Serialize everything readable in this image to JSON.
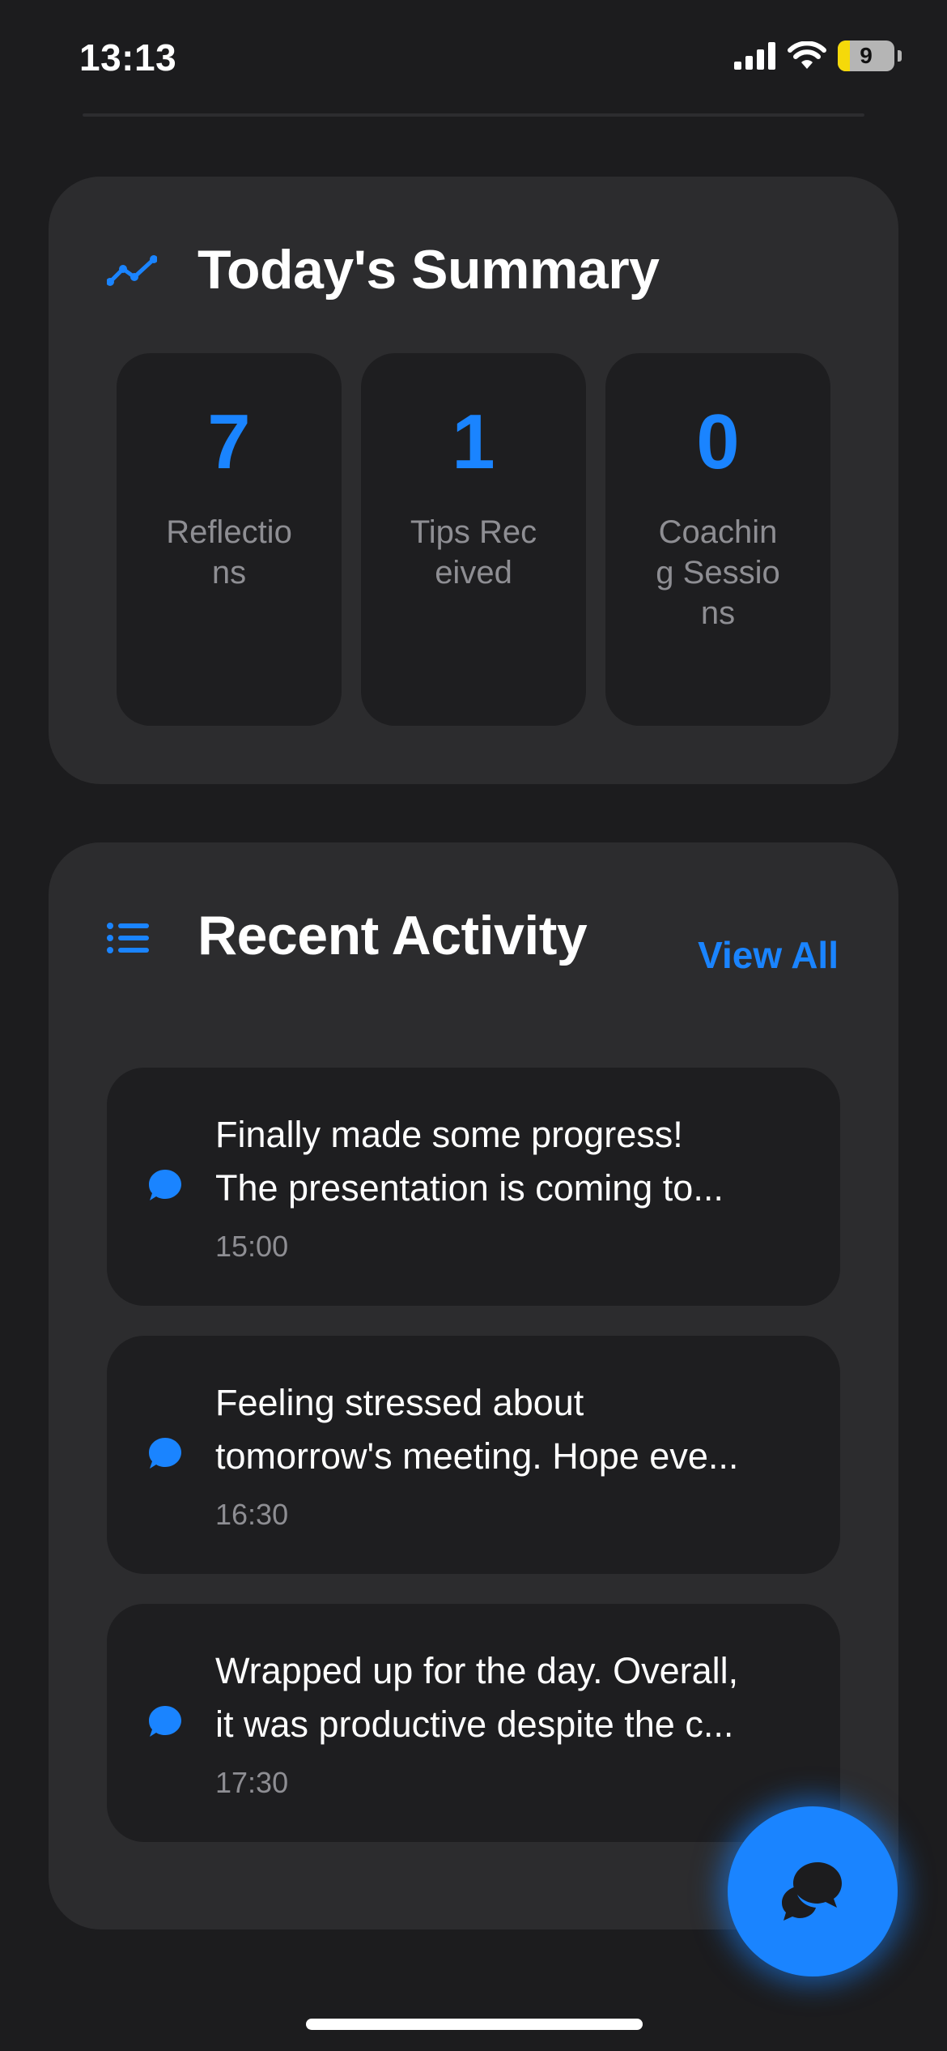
{
  "status_bar": {
    "time": "13:13",
    "battery_level": "9",
    "icons": [
      "cellular-signal-icon",
      "wifi-icon",
      "battery-icon"
    ]
  },
  "summary": {
    "title": "Today's Summary",
    "icon": "trend-line-icon",
    "stats": [
      {
        "value": "7",
        "label": "Reflections"
      },
      {
        "value": "1",
        "label": "Tips Received"
      },
      {
        "value": "0",
        "label": "Coaching Sessions"
      }
    ]
  },
  "activity": {
    "title": "Recent Activity",
    "icon": "list-icon",
    "view_all_label": "View All",
    "items": [
      {
        "line1": "Finally made some progress!",
        "line2": "The presentation is coming to...",
        "time": "15:00",
        "icon": "chat-bubble-icon"
      },
      {
        "line1": "Feeling stressed about",
        "line2": "tomorrow's meeting. Hope eve...",
        "time": "16:30",
        "icon": "chat-bubble-icon"
      },
      {
        "line1": "Wrapped up for the day. Overall,",
        "line2": "it was productive despite the c...",
        "time": "17:30",
        "icon": "chat-bubble-icon"
      }
    ]
  },
  "fab": {
    "icon": "chat-bubbles-icon"
  },
  "colors": {
    "background": "#1c1c1e",
    "card": "#2c2c2e",
    "tile": "#1e1e20",
    "accent": "#1a84ff",
    "secondary_text": "#8e8e93"
  }
}
